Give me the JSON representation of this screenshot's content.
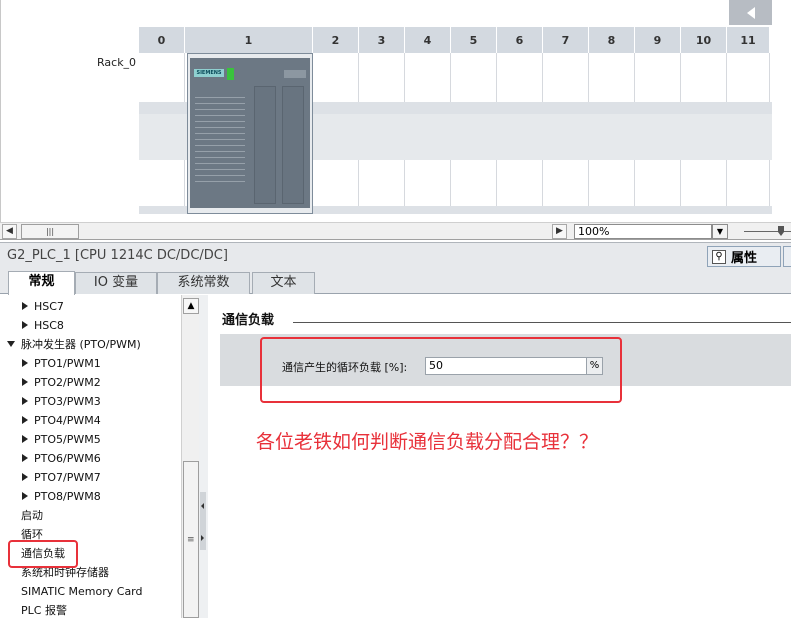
{
  "rack": {
    "name": "Rack_0",
    "slots": [
      "0",
      "1",
      "2",
      "3",
      "4",
      "5",
      "6",
      "7",
      "8",
      "9",
      "10",
      "11"
    ]
  },
  "toolbar": {
    "zoom": "100%"
  },
  "inspector": {
    "title": "G2_PLC_1 [CPU 1214C DC/DC/DC]",
    "properties_label": "属性"
  },
  "tabs": [
    "常规",
    "IO 变量",
    "系统常数",
    "文本"
  ],
  "tree": {
    "items": [
      {
        "label": "HSC7",
        "arrow": "right"
      },
      {
        "label": "HSC8",
        "arrow": "right"
      },
      {
        "label": "脉冲发生器 (PTO/PWM)",
        "arrow": "down"
      },
      {
        "label": "PTO1/PWM1",
        "arrow": "right"
      },
      {
        "label": "PTO2/PWM2",
        "arrow": "right"
      },
      {
        "label": "PTO3/PWM3",
        "arrow": "right"
      },
      {
        "label": "PTO4/PWM4",
        "arrow": "right"
      },
      {
        "label": "PTO5/PWM5",
        "arrow": "right"
      },
      {
        "label": "PTO6/PWM6",
        "arrow": "right"
      },
      {
        "label": "PTO7/PWM7",
        "arrow": "right"
      },
      {
        "label": "PTO8/PWM8",
        "arrow": "right"
      },
      {
        "label": "启动",
        "arrow": "none"
      },
      {
        "label": "循环",
        "arrow": "none"
      },
      {
        "label": "通信负载",
        "arrow": "none"
      },
      {
        "label": "系统和时钟存储器",
        "arrow": "none"
      },
      {
        "label": "SIMATIC Memory Card",
        "arrow": "none"
      },
      {
        "label": "PLC 报警",
        "arrow": "none"
      }
    ],
    "selected": "通信负载"
  },
  "content": {
    "section_title": "通信负载",
    "field_label": "通信产生的循环负载 [%]:",
    "field_value": "50",
    "field_unit": "%",
    "annotation": "各位老铁如何判断通信负载分配合理？？"
  },
  "colors": {
    "highlight": "#e8313a",
    "slot_header": "#d3d9e0",
    "cpu_body": "#6c7884"
  }
}
